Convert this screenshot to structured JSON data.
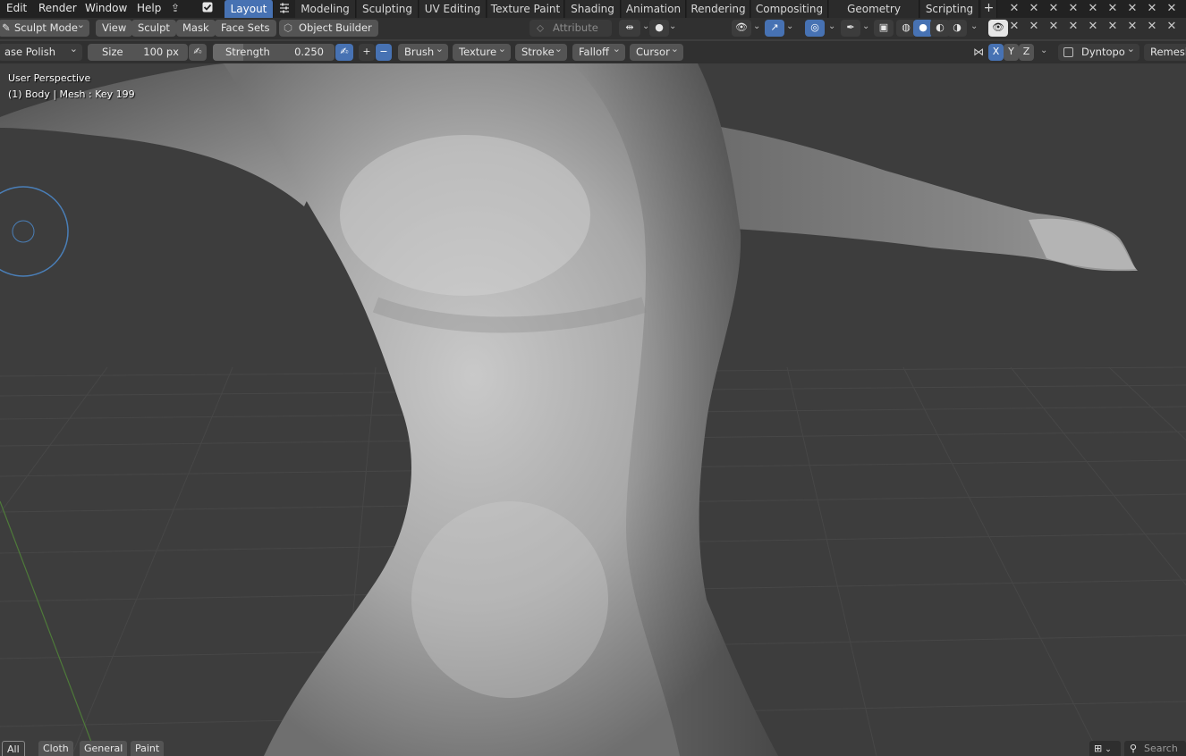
{
  "menu": {
    "edit": "Edit",
    "render": "Render",
    "window": "Window",
    "help": "Help"
  },
  "workspaces": [
    "Layout",
    "Modeling",
    "Sculpting",
    "UV Editing",
    "Texture Paint",
    "Shading",
    "Animation",
    "Rendering",
    "Compositing",
    "Geometry Nodes",
    "Scripting"
  ],
  "active_workspace": "Layout",
  "add_workspace": "+",
  "header": {
    "mode": "Sculpt Mode",
    "view": "View",
    "sculpt": "Sculpt",
    "mask": "Mask",
    "face_sets": "Face Sets",
    "object_builder": "Object Builder",
    "attribute": "Attribute"
  },
  "tool_settings": {
    "brush_name": "ase Polish",
    "size_label": "Size",
    "size_value": "100 px",
    "strength_label": "Strength",
    "strength_value": "0.250",
    "strength_fraction": 0.25,
    "plus": "+",
    "minus": "−",
    "brush": "Brush",
    "texture": "Texture",
    "stroke": "Stroke",
    "falloff": "Falloff",
    "cursor": "Cursor",
    "axis_x": "X",
    "axis_y": "Y",
    "axis_z": "Z",
    "dyntopo": "Dyntopo",
    "remesh": "Remesh"
  },
  "viewport": {
    "perspective": "User Perspective",
    "object_info": "(1) Body | Mesh : Key 199"
  },
  "bottom": {
    "tabs": [
      "All",
      "Cloth",
      "General",
      "Paint"
    ],
    "active_tab": "All",
    "search_placeholder": "Search"
  },
  "colors": {
    "accent": "#4772b3",
    "header_bg": "#303030",
    "topbar_bg": "#222222",
    "viewport_bg": "#3d3d3d",
    "brush_cursor": "#4a7fb8"
  }
}
